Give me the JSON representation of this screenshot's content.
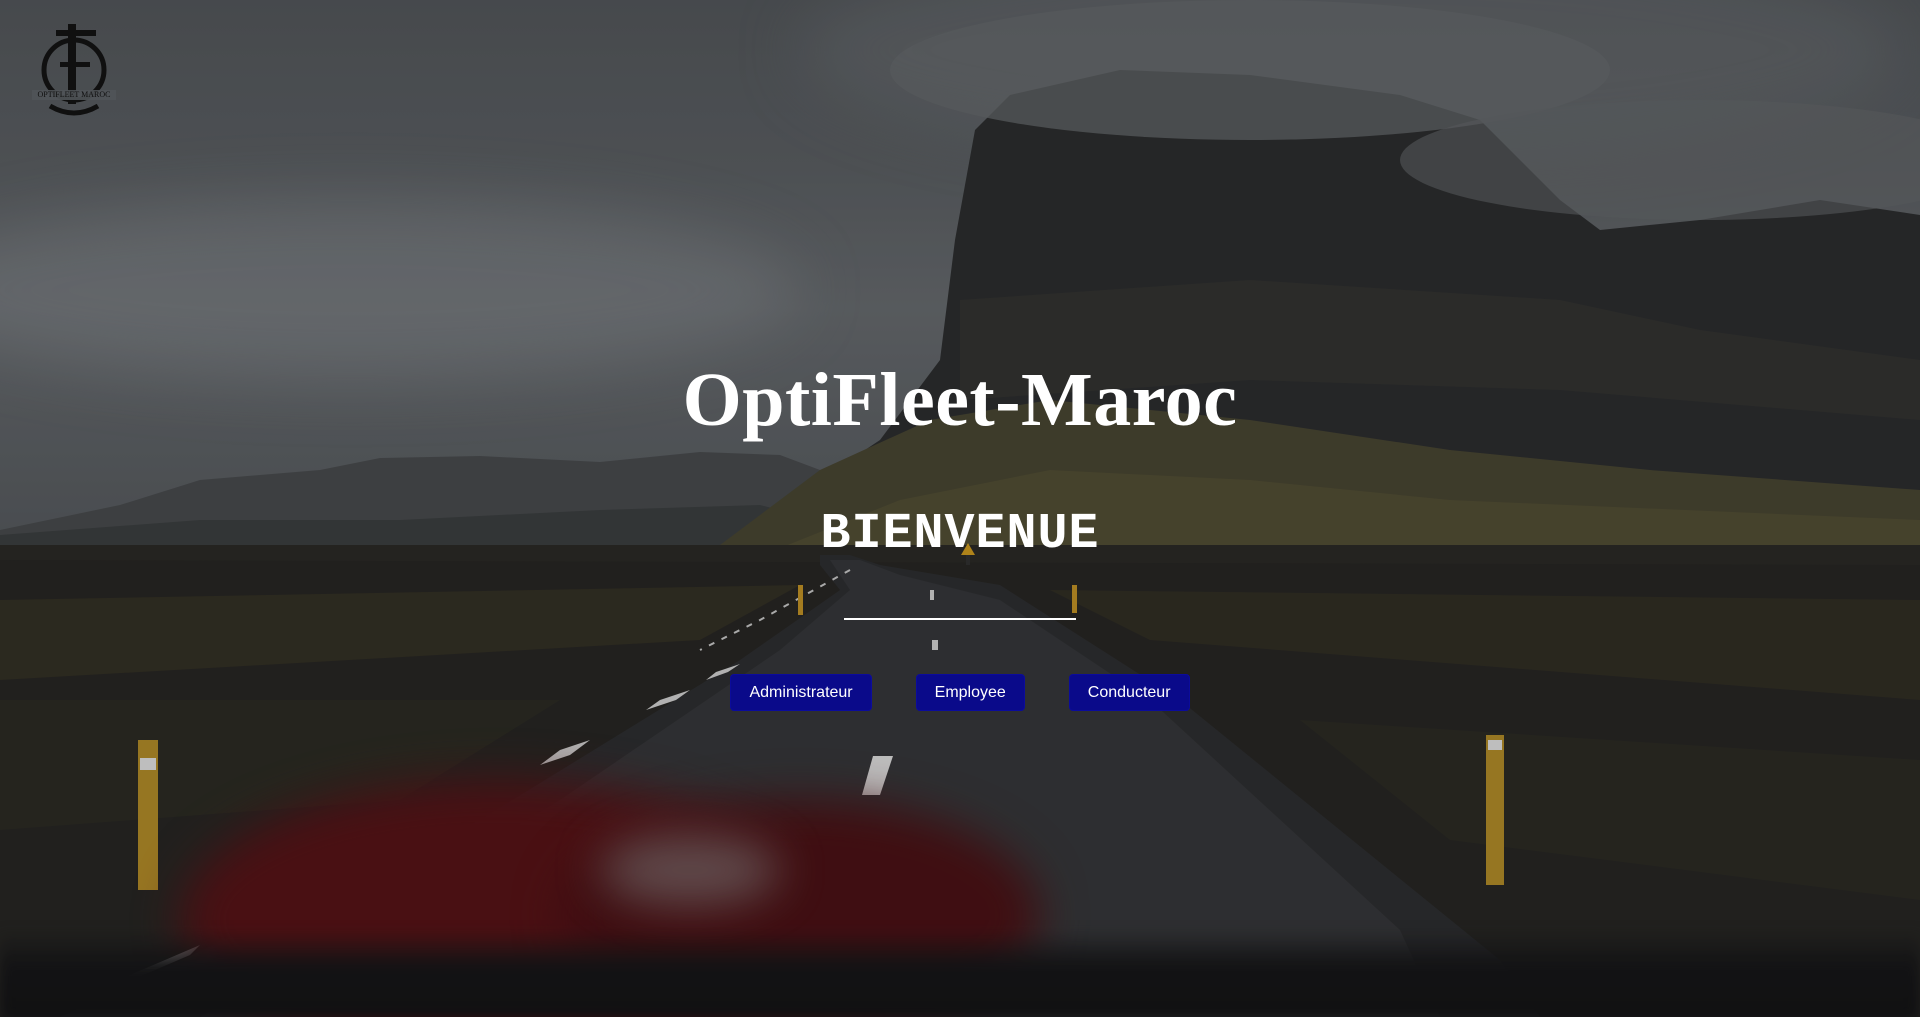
{
  "brand": {
    "logo_text": "OPTIFLEET MAROC",
    "logo_monogram": "FO"
  },
  "hero": {
    "title": "OptiFleet-Maroc",
    "subtitle": "BIENVENUE"
  },
  "roles": [
    {
      "label": "Administrateur"
    },
    {
      "label": "Employee"
    },
    {
      "label": "Conducteur"
    }
  ],
  "colors": {
    "button_bg": "#0a0a8a",
    "text": "#ffffff"
  }
}
